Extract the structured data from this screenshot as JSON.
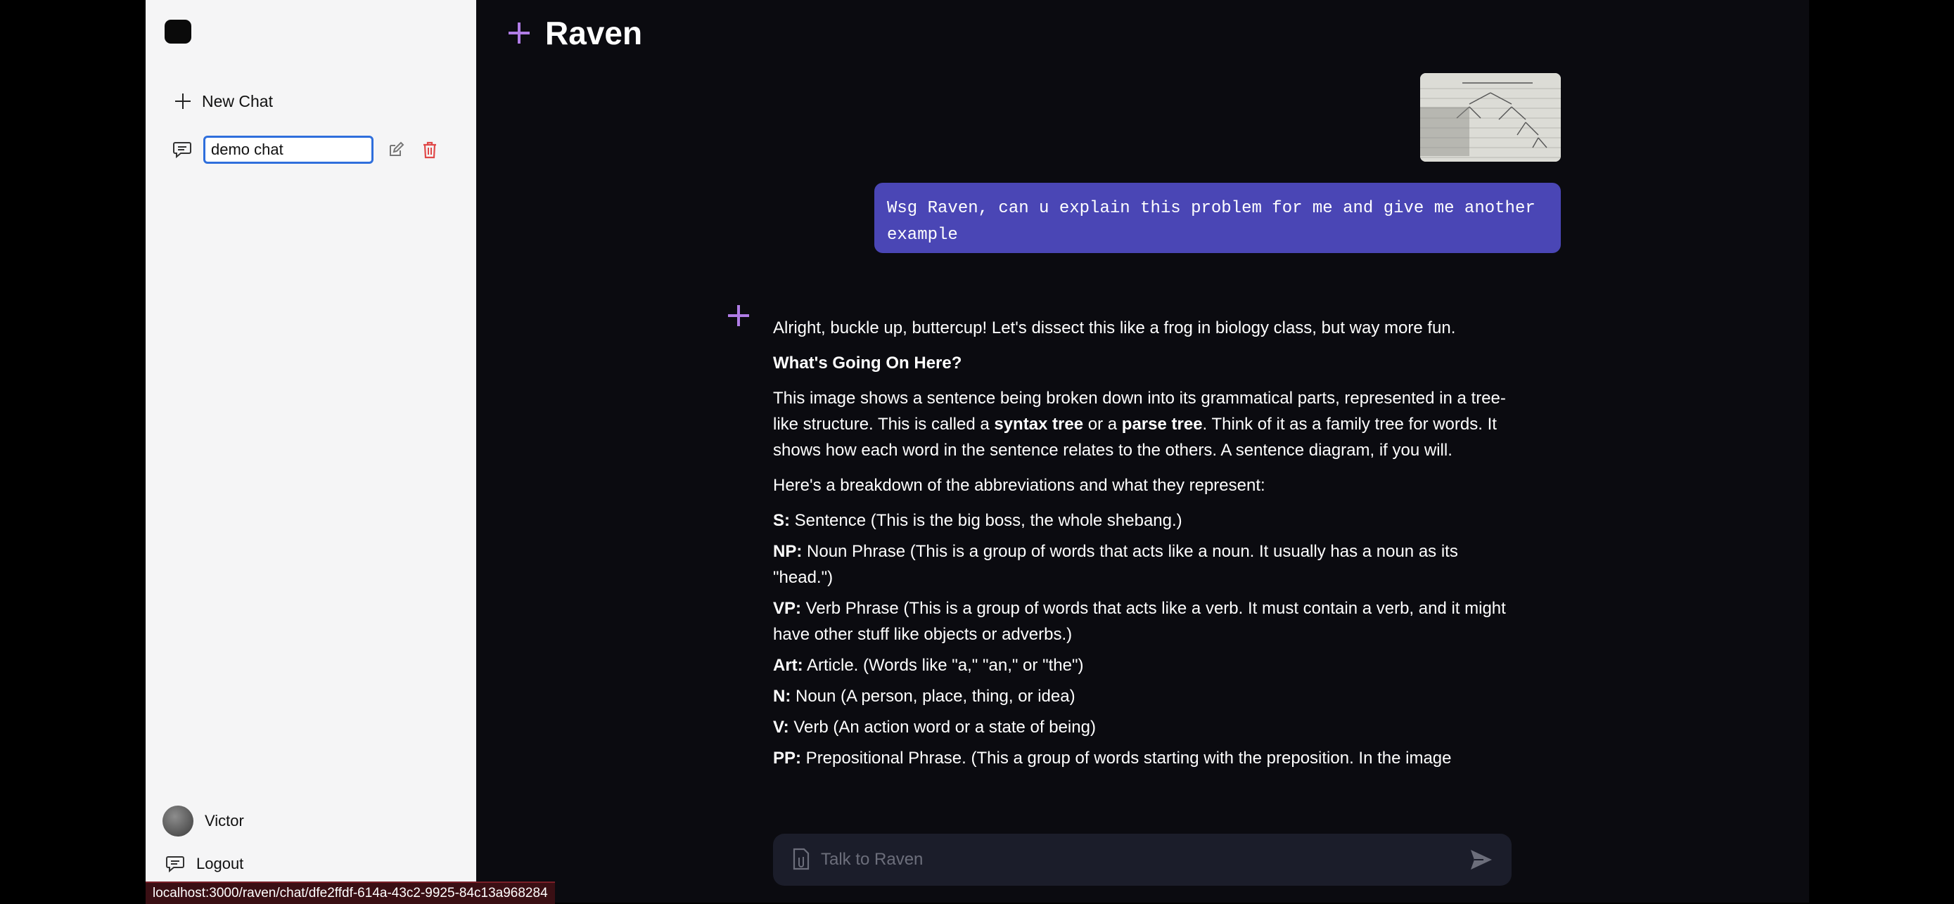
{
  "sidebar": {
    "new_chat_label": "New Chat",
    "chat_name_value": "demo chat",
    "user_name": "Victor",
    "logout_label": "Logout"
  },
  "header": {
    "title": "Raven"
  },
  "conversation": {
    "user_message": "Wsg Raven, can u explain this problem for me and give me another example",
    "bot": {
      "intro": "Alright, buckle up, buttercup! Let's dissect this like a frog in biology class, but way more fun.",
      "heading": "What's Going On Here?",
      "para1_a": "This image shows a sentence being broken down into its grammatical parts, represented in a tree-like structure. This is called a ",
      "para1_b1": "syntax tree",
      "para1_c": " or a ",
      "para1_b2": "parse tree",
      "para1_d": ". Think of it as a family tree for words. It shows how each word in the sentence relates to the others. A sentence diagram, if you will.",
      "para2": "Here's a breakdown of the abbreviations and what they represent:",
      "definitions": [
        {
          "term": "S:",
          "text": " Sentence (This is the big boss, the whole shebang.)"
        },
        {
          "term": "NP:",
          "text": " Noun Phrase (This is a group of words that acts like a noun. It usually has a noun as its \"head.\")"
        },
        {
          "term": "VP:",
          "text": " Verb Phrase (This is a group of words that acts like a verb. It must contain a verb, and it might have other stuff like objects or adverbs.)"
        },
        {
          "term": "Art:",
          "text": " Article. (Words like \"a,\" \"an,\" or \"the\")"
        },
        {
          "term": "N:",
          "text": " Noun (A person, place, thing, or idea)"
        },
        {
          "term": "V:",
          "text": " Verb (An action word or a state of being)"
        },
        {
          "term": "PP:",
          "text": " Prepositional Phrase. (This a group of words starting with the preposition. In the image"
        }
      ]
    }
  },
  "composer": {
    "placeholder": "Talk to Raven"
  },
  "status_bar": {
    "url": "localhost:3000/raven/chat/dfe2ffdf-614a-43c2-9925-84c13a968284"
  },
  "colors": {
    "accent": "#b07ce6",
    "user_bubble": "#4a46b5",
    "delete": "#e04848",
    "focus": "#2f6fdc"
  },
  "icons": [
    "logo",
    "plus-icon",
    "chat-bubble-icon",
    "edit-icon",
    "trash-icon",
    "avatar",
    "logout-icon",
    "raven-plus-icon",
    "attach-icon",
    "send-icon"
  ]
}
